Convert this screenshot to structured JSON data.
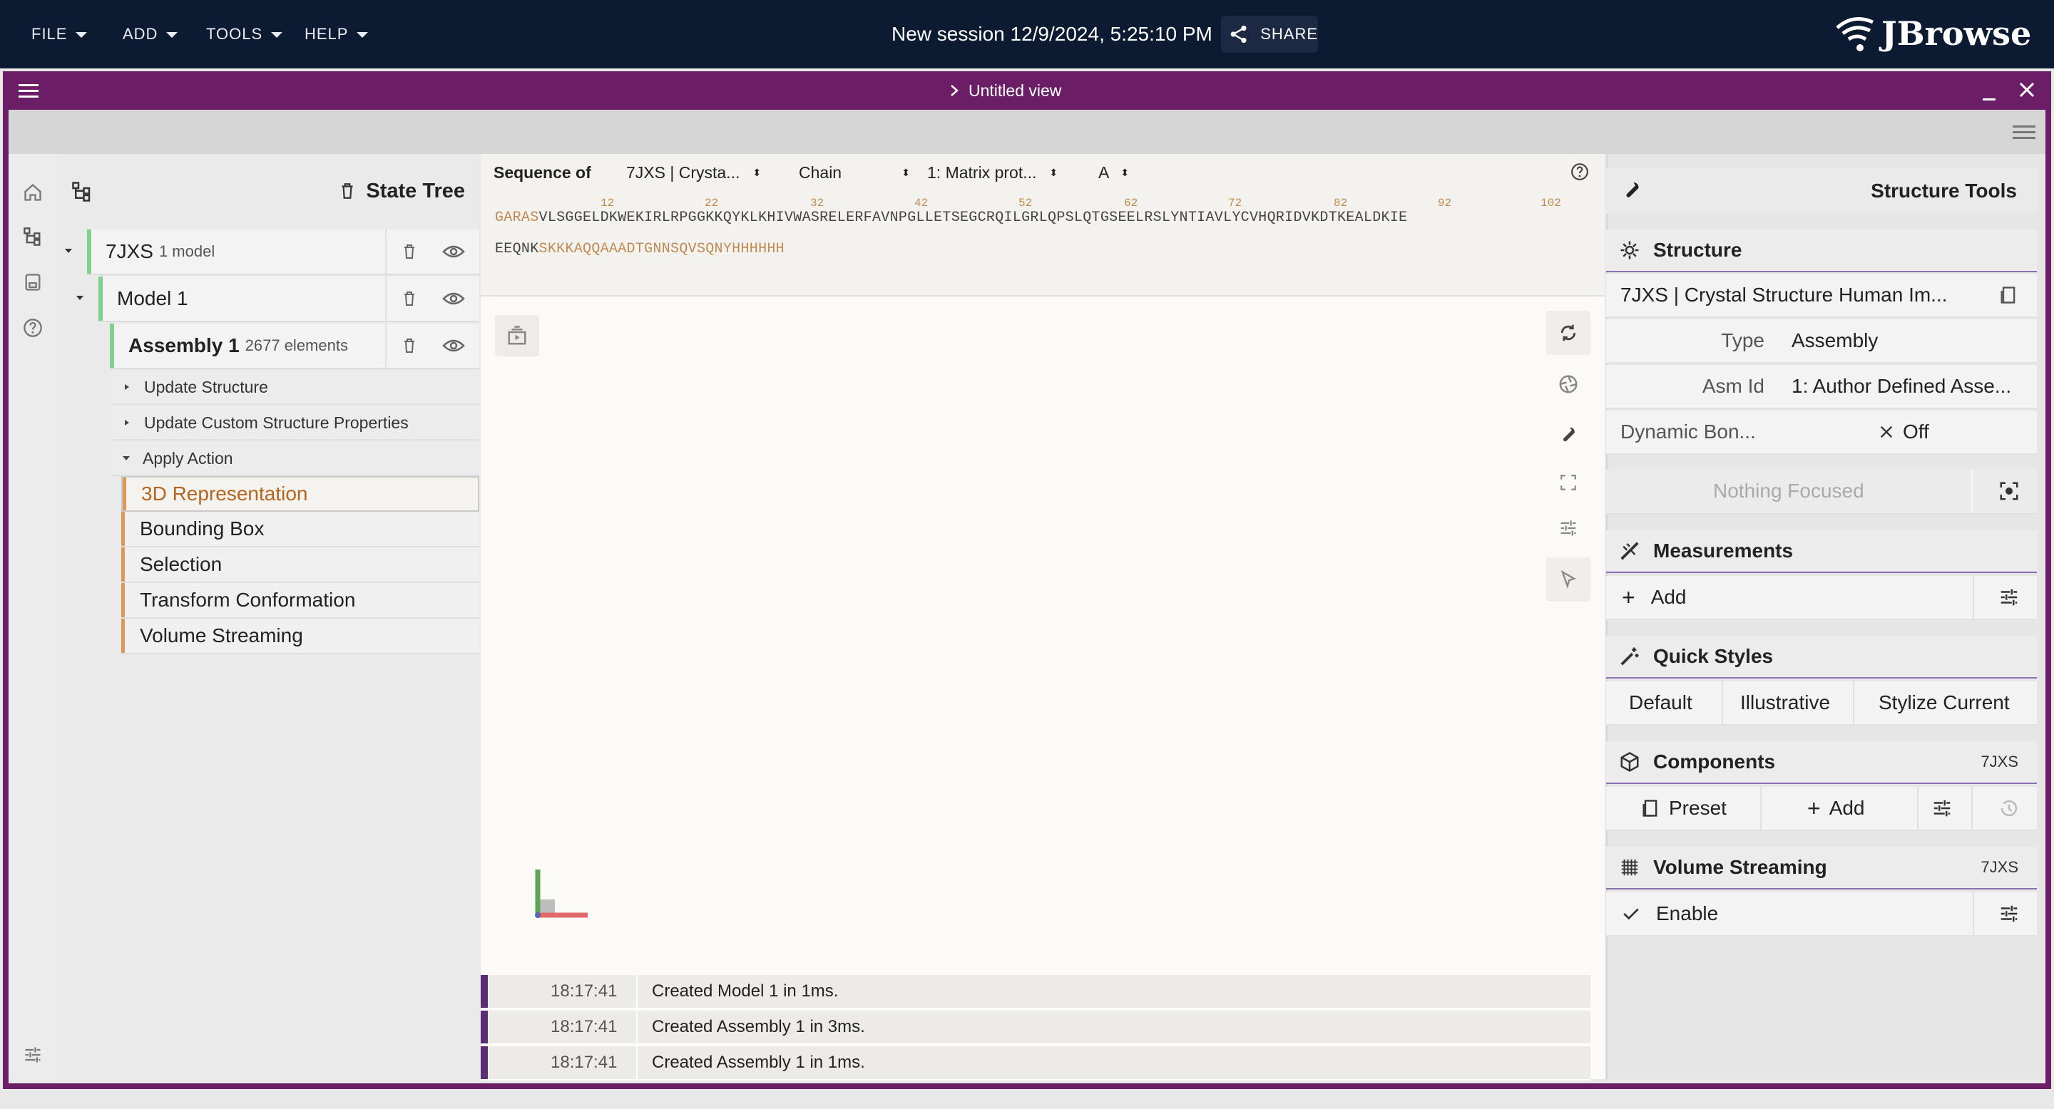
{
  "topbar": {
    "menus": [
      "FILE",
      "ADD",
      "TOOLS",
      "HELP"
    ],
    "session_title": "New session 12/9/2024, 5:25:10 PM",
    "share_label": "SHARE",
    "logo_text": "JBrowse"
  },
  "view": {
    "title": "Untitled view"
  },
  "state_tree": {
    "title": "State Tree",
    "nodes": [
      {
        "label": "7JXS",
        "meta": "1 model"
      },
      {
        "label": "Model 1",
        "meta": ""
      },
      {
        "label": "Assembly 1",
        "meta": "2677 elements"
      }
    ],
    "actions": [
      "Update Structure",
      "Update Custom Structure Properties",
      "Apply Action"
    ],
    "representations": [
      "3D Representation",
      "Bounding Box",
      "Selection",
      "Transform Conformation",
      "Volume Streaming"
    ]
  },
  "sequence": {
    "label": "Sequence of",
    "structure_select": "7JXS | Crysta...",
    "chain_select": "Chain",
    "entity_select": "1: Matrix prot...",
    "chain_id_select": "A",
    "line1_prefix": "GARAS",
    "line1_main": "VLSGGELDKWEKIRLRPGGKKQYKLKHIVWASRELERFAVNPGLLETSEGCRQILGRLQPSLQTGSEELRSLYNTIAVLYCVHQRIDVKDTKEALDKIE",
    "line2_main": "EEQNK",
    "line2_suffix": "SKKKAQQAAADTGNNSQVSQNYHHHHHH",
    "numbers": [
      "12",
      "22",
      "32",
      "42",
      "52",
      "62",
      "72",
      "82",
      "92",
      "102"
    ]
  },
  "log": [
    {
      "time": "18:17:41",
      "message": "Created Model 1 in 1ms."
    },
    {
      "time": "18:17:41",
      "message": "Created Assembly 1 in 3ms."
    },
    {
      "time": "18:17:41",
      "message": "Created Assembly 1 in 1ms."
    }
  ],
  "structure_tools": {
    "title": "Structure Tools",
    "structure_section": "Structure",
    "structure_name": "7JXS | Crystal Structure Human Im...",
    "type_label": "Type",
    "type_value": "Assembly",
    "asm_label": "Asm Id",
    "asm_value": "1: Author Defined Asse...",
    "dyn_label": "Dynamic Bon...",
    "dyn_value": "Off",
    "nothing_focused": "Nothing Focused",
    "measurements_section": "Measurements",
    "add_label": "Add",
    "quick_styles_section": "Quick Styles",
    "quick_styles": [
      "Default",
      "Illustrative",
      "Stylize Current"
    ],
    "components_section": "Components",
    "components_badge": "7JXS",
    "preset_label": "Preset",
    "components_add": "Add",
    "volume_section": "Volume Streaming",
    "volume_badge": "7JXS",
    "enable_label": "Enable"
  },
  "colors": {
    "header": "#0c1b32",
    "view_bar": "#6b1d66",
    "tree_accent": "#7fd08e",
    "rep_accent": "#d89a56",
    "selected_rep_text": "#b5651d",
    "log_accent": "#5b2d72"
  }
}
